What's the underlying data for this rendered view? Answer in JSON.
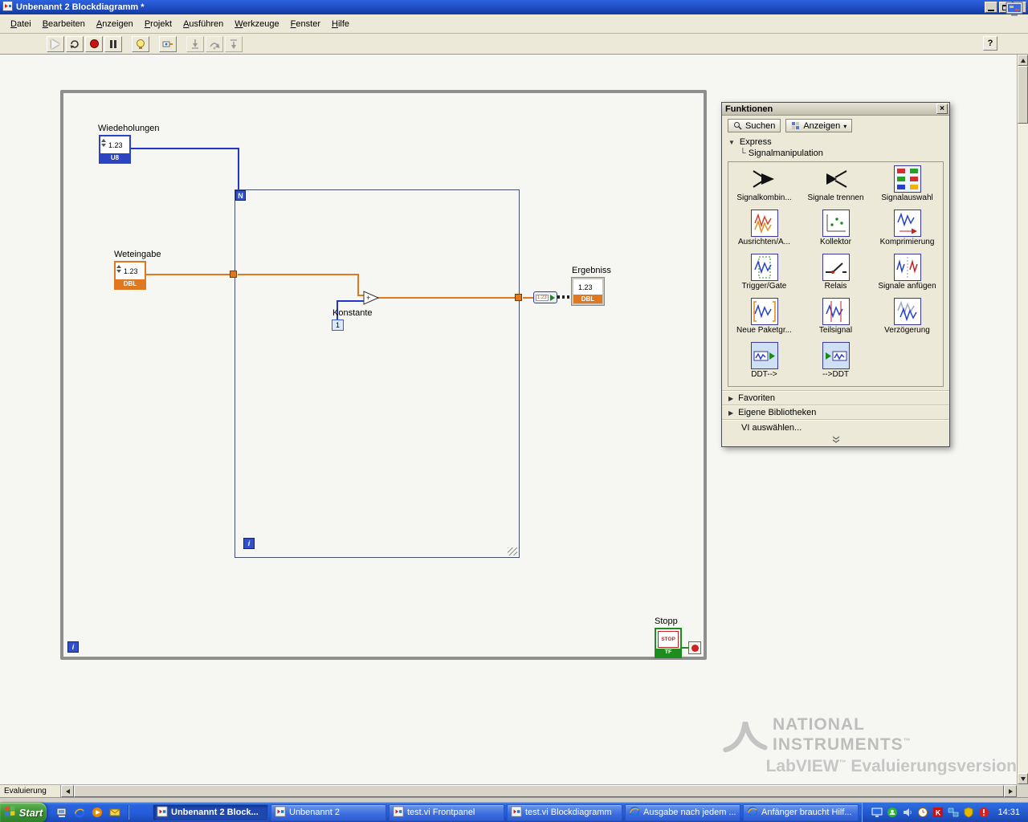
{
  "window": {
    "title": "Unbenannt 2 Blockdiagramm *"
  },
  "menubar": {
    "items": [
      "Datei",
      "Bearbeiten",
      "Anzeigen",
      "Projekt",
      "Ausführen",
      "Werkzeuge",
      "Fenster",
      "Hilfe"
    ]
  },
  "toolbar": {
    "help_label": "?"
  },
  "diagram": {
    "wiederholungen": {
      "label": "Wiedeholungen",
      "value": "1.23",
      "type": "U8"
    },
    "werteingabe": {
      "label": "Weteingabe",
      "value": "1.23",
      "type": "DBL"
    },
    "konstante": {
      "label": "Konstante",
      "value": "1"
    },
    "add_node": {
      "symbol": "+"
    },
    "conversion": {
      "value": "1.23"
    },
    "ergebniss": {
      "label": "Ergebniss",
      "value": "1.23",
      "type": "DBL"
    },
    "stopp": {
      "label": "Stopp",
      "button_text": "STOP",
      "type": "TF"
    },
    "for_loop": {
      "count_terminal": "N",
      "iteration_terminal": "i"
    },
    "while_loop": {
      "iteration_terminal": "i"
    }
  },
  "palette": {
    "title": "Funktionen",
    "search_label": "Suchen",
    "view_label": "Anzeigen",
    "express_label": "Express",
    "express_sublabel": "Signalmanipulation",
    "items": [
      {
        "label": "Signalkombin...",
        "icon": "merge-signals-icon"
      },
      {
        "label": "Signale trennen",
        "icon": "split-signals-icon"
      },
      {
        "label": "Signalauswahl",
        "icon": "select-signals-icon"
      },
      {
        "label": "Ausrichten/A...",
        "icon": "align-resample-icon"
      },
      {
        "label": "Kollektor",
        "icon": "collector-icon"
      },
      {
        "label": "Komprimierung",
        "icon": "compress-icon"
      },
      {
        "label": "Trigger/Gate",
        "icon": "trigger-gate-icon"
      },
      {
        "label": "Relais",
        "icon": "relay-icon"
      },
      {
        "label": "Signale anfügen",
        "icon": "append-signals-icon"
      },
      {
        "label": "Neue Paketgr...",
        "icon": "repackage-icon"
      },
      {
        "label": "Teilsignal",
        "icon": "subsignal-icon"
      },
      {
        "label": "Verzögerung",
        "icon": "delay-icon"
      },
      {
        "label": "DDT-->",
        "icon": "from-ddt-icon"
      },
      {
        "label": "-->DDT",
        "icon": "to-ddt-icon"
      }
    ],
    "more_sections": [
      {
        "label": "Favoriten"
      },
      {
        "label": "Eigene Bibliotheken"
      }
    ],
    "select_vi_label": "VI auswählen..."
  },
  "statusbar": {
    "mode": "Evaluierung"
  },
  "watermark": {
    "brand_line1": "NATIONAL",
    "brand_line2": "INSTRUMENTS",
    "trademark": "™",
    "product": "LabVIEW",
    "edition": "Evaluierungsversion"
  },
  "taskbar": {
    "start_label": "Start",
    "quicklaunch": [
      "show-desktop-icon",
      "ie-icon",
      "media-player-icon",
      "outlook-icon"
    ],
    "tasks": [
      {
        "label": "Unbenannt 2 Block...",
        "icon": "labview-icon",
        "active": true
      },
      {
        "label": "Unbenannt 2",
        "icon": "labview-icon",
        "active": false
      },
      {
        "label": "test.vi Frontpanel",
        "icon": "labview-icon",
        "active": false
      },
      {
        "label": "test.vi Blockdiagramm",
        "icon": "labview-icon",
        "active": false
      },
      {
        "label": "Ausgabe nach jedem ...",
        "icon": "ie-icon",
        "active": false
      },
      {
        "label": "Anfänger braucht Hilf...",
        "icon": "ie-icon",
        "active": false
      }
    ],
    "tray_icons": [
      "display-icon",
      "messenger-icon",
      "volume-icon",
      "scheduler-icon",
      "antivirus-icon",
      "network-icon",
      "shield-icon",
      "alert-icon"
    ],
    "clock": "14:31"
  }
}
